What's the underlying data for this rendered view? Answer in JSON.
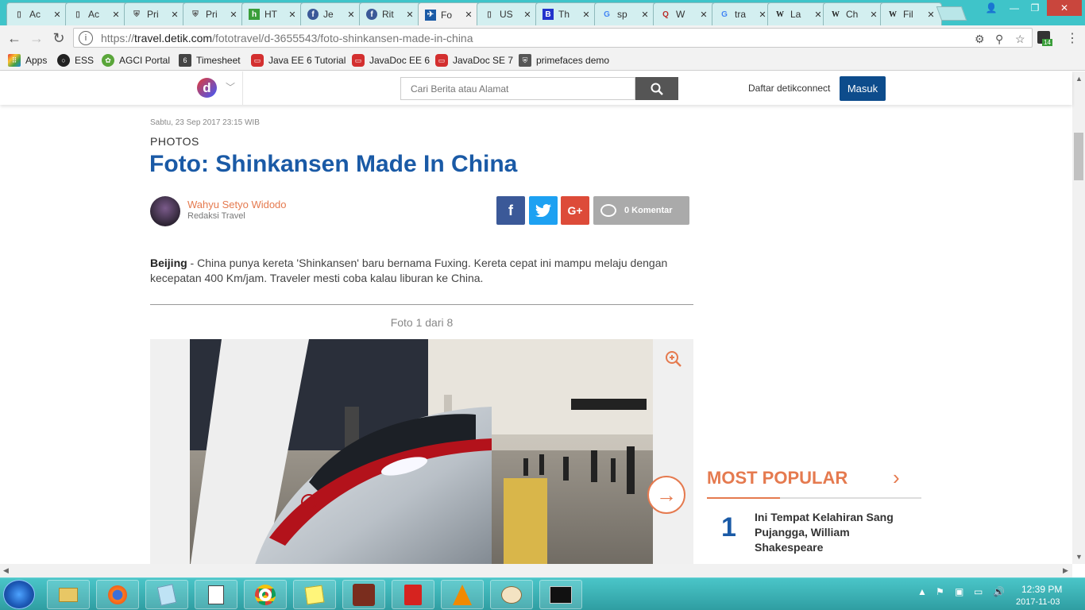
{
  "browser": {
    "tabs": [
      {
        "title": "Ac",
        "icon": "doc-icon"
      },
      {
        "title": "Ac",
        "icon": "doc-icon"
      },
      {
        "title": "Pri",
        "icon": "shield-icon"
      },
      {
        "title": "Pri",
        "icon": "shield-icon"
      },
      {
        "title": "HT",
        "icon": "html-icon"
      },
      {
        "title": "Je",
        "icon": "facebook-icon"
      },
      {
        "title": "Rit",
        "icon": "facebook-icon"
      },
      {
        "title": "Fo",
        "icon": "detik-icon",
        "active": true
      },
      {
        "title": "US",
        "icon": "doc-icon"
      },
      {
        "title": "Th",
        "icon": "b-icon"
      },
      {
        "title": "sp",
        "icon": "google-icon"
      },
      {
        "title": "W",
        "icon": "quora-icon"
      },
      {
        "title": "tra",
        "icon": "google-icon"
      },
      {
        "title": "La",
        "icon": "wikipedia-icon"
      },
      {
        "title": "Ch",
        "icon": "wikipedia-icon"
      },
      {
        "title": "Fil",
        "icon": "wikipedia-icon"
      }
    ],
    "url": {
      "protocol": "https://",
      "host": "travel.detik.com",
      "path": "/fototravel/d-3655543/foto-shinkansen-made-in-china"
    },
    "extension_badge": "14",
    "bookmarks": [
      {
        "label": "Apps",
        "icon": "apps-grid-icon"
      },
      {
        "label": "ESS",
        "icon": "circle-icon"
      },
      {
        "label": "AGCI Portal",
        "icon": "leaf-icon"
      },
      {
        "label": "Timesheet",
        "icon": "eap-icon"
      },
      {
        "label": "Java EE 6 Tutorial",
        "icon": "oracle-icon"
      },
      {
        "label": "JavaDoc EE 6",
        "icon": "oracle-icon"
      },
      {
        "label": "JavaDoc SE 7",
        "icon": "oracle-icon"
      },
      {
        "label": "primefaces demo",
        "icon": "shield-icon"
      }
    ]
  },
  "site": {
    "logo_letter": "d",
    "search_placeholder": "Cari Berita atau Alamat",
    "register_label": "Daftar detikconnect",
    "login_label": "Masuk"
  },
  "article": {
    "date": "Sabtu, 23 Sep 2017 23:15 WIB",
    "category": "PHOTOS",
    "headline": "Foto: Shinkansen Made In China",
    "author_name": "Wahyu Setyo Widodo",
    "author_role": "Redaksi Travel",
    "comments_label": "0 Komentar",
    "lead_place": "Beijing",
    "lead_text": " - China punya kereta 'Shinkansen' baru bernama Fuxing. Kereta cepat ini mampu melaju dengan kecepatan 400 Km/jam. Traveler mesti coba kalau liburan ke China.",
    "photo_counter": "Foto 1 dari 8"
  },
  "sidebar": {
    "most_popular_title": "MOST POPULAR",
    "items": [
      {
        "rank": "1",
        "title": "Ini Tempat Kelahiran Sang Pujangga, William Shakespeare"
      }
    ]
  },
  "taskbar": {
    "time": "12:39 PM",
    "date": "2017-11-03",
    "apps": [
      "explorer-icon",
      "firefox-icon",
      "notepad-icon",
      "notepadpp-icon",
      "chrome-icon",
      "sticky-notes-icon",
      "java-ide-icon",
      "acrobat-icon",
      "vlc-icon",
      "paint-icon",
      "cmd-icon"
    ]
  },
  "colors": {
    "tabstrip": "#3fc4c9",
    "headline": "#1a5aa6",
    "accent_orange": "#e57a4f",
    "login_button": "#0d4c8c",
    "facebook": "#3b5998",
    "twitter": "#1da1f2",
    "googleplus": "#dd4b39"
  }
}
